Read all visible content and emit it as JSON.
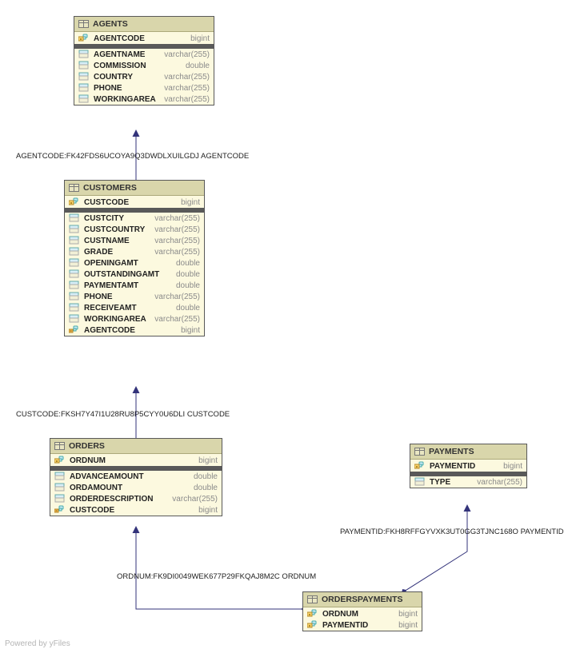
{
  "footer": "Powered by yFiles",
  "nodes": {
    "agents": {
      "title": "AGENTS",
      "key": {
        "name": "AGENTCODE",
        "type": "bigint"
      },
      "cols": [
        {
          "name": "AGENTNAME",
          "type": "varchar(255)"
        },
        {
          "name": "COMMISSION",
          "type": "double"
        },
        {
          "name": "COUNTRY",
          "type": "varchar(255)"
        },
        {
          "name": "PHONE",
          "type": "varchar(255)"
        },
        {
          "name": "WORKINGAREA",
          "type": "varchar(255)"
        }
      ]
    },
    "customers": {
      "title": "CUSTOMERS",
      "key": {
        "name": "CUSTCODE",
        "type": "bigint"
      },
      "cols": [
        {
          "name": "CUSTCITY",
          "type": "varchar(255)"
        },
        {
          "name": "CUSTCOUNTRY",
          "type": "varchar(255)"
        },
        {
          "name": "CUSTNAME",
          "type": "varchar(255)"
        },
        {
          "name": "GRADE",
          "type": "varchar(255)"
        },
        {
          "name": "OPENINGAMT",
          "type": "double"
        },
        {
          "name": "OUTSTANDINGAMT",
          "type": "double"
        },
        {
          "name": "PAYMENTAMT",
          "type": "double"
        },
        {
          "name": "PHONE",
          "type": "varchar(255)"
        },
        {
          "name": "RECEIVEAMT",
          "type": "double"
        },
        {
          "name": "WORKINGAREA",
          "type": "varchar(255)"
        },
        {
          "name": "AGENTCODE",
          "type": "bigint"
        }
      ]
    },
    "orders": {
      "title": "ORDERS",
      "key": {
        "name": "ORDNUM",
        "type": "bigint"
      },
      "cols": [
        {
          "name": "ADVANCEAMOUNT",
          "type": "double"
        },
        {
          "name": "ORDAMOUNT",
          "type": "double"
        },
        {
          "name": "ORDERDESCRIPTION",
          "type": "varchar(255)"
        },
        {
          "name": "CUSTCODE",
          "type": "bigint"
        }
      ]
    },
    "payments": {
      "title": "PAYMENTS",
      "key": {
        "name": "PAYMENTID",
        "type": "bigint"
      },
      "cols": [
        {
          "name": "TYPE",
          "type": "varchar(255)"
        }
      ]
    },
    "orderspayments": {
      "title": "ORDERSPAYMENTS",
      "keys": [
        {
          "name": "ORDNUM",
          "type": "bigint"
        },
        {
          "name": "PAYMENTID",
          "type": "bigint"
        }
      ]
    }
  },
  "relations": {
    "r1": "AGENTCODE:FK42FDS6UCOYA9Q3DWDLXUILGDJ AGENTCODE",
    "r2": "CUSTCODE:FKSH7Y47I1U28RU8P5CYY0U6DLI CUSTCODE",
    "r3": "ORDNUM:FK9DI0049WEK677P29FKQAJ8M2C ORDNUM",
    "r4": "PAYMENTID:FKH8RFFGYVXK3UT0GG3TJNC168O PAYMENTID"
  },
  "chart_data": {
    "type": "diagram",
    "entities": [
      {
        "name": "AGENTS",
        "pk": [
          "AGENTCODE"
        ],
        "columns": [
          "AGENTNAME",
          "COMMISSION",
          "COUNTRY",
          "PHONE",
          "WORKINGAREA"
        ]
      },
      {
        "name": "CUSTOMERS",
        "pk": [
          "CUSTCODE"
        ],
        "columns": [
          "CUSTCITY",
          "CUSTCOUNTRY",
          "CUSTNAME",
          "GRADE",
          "OPENINGAMT",
          "OUTSTANDINGAMT",
          "PAYMENTAMT",
          "PHONE",
          "RECEIVEAMT",
          "WORKINGAREA",
          "AGENTCODE"
        ]
      },
      {
        "name": "ORDERS",
        "pk": [
          "ORDNUM"
        ],
        "columns": [
          "ADVANCEAMOUNT",
          "ORDAMOUNT",
          "ORDERDESCRIPTION",
          "CUSTCODE"
        ]
      },
      {
        "name": "PAYMENTS",
        "pk": [
          "PAYMENTID"
        ],
        "columns": [
          "TYPE"
        ]
      },
      {
        "name": "ORDERSPAYMENTS",
        "pk": [
          "ORDNUM",
          "PAYMENTID"
        ],
        "columns": []
      }
    ],
    "relationships": [
      {
        "from": "CUSTOMERS.AGENTCODE",
        "to": "AGENTS.AGENTCODE",
        "label": "FK42FDS6UCOYA9Q3DWDLXUILGDJ"
      },
      {
        "from": "ORDERS.CUSTCODE",
        "to": "CUSTOMERS.CUSTCODE",
        "label": "FKSH7Y47I1U28RU8P5CYY0U6DLI"
      },
      {
        "from": "ORDERSPAYMENTS.ORDNUM",
        "to": "ORDERS.ORDNUM",
        "label": "FK9DI0049WEK677P29FKQAJ8M2C"
      },
      {
        "from": "ORDERSPAYMENTS.PAYMENTID",
        "to": "PAYMENTS.PAYMENTID",
        "label": "FKH8RFFGYVXK3UT0GG3TJNC168O"
      }
    ]
  }
}
